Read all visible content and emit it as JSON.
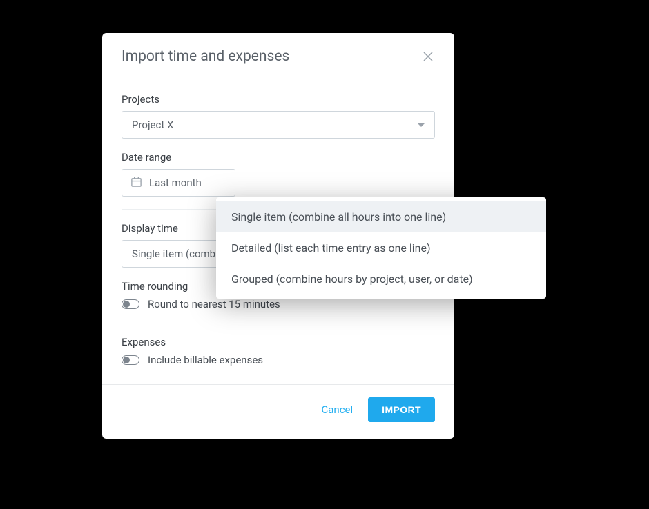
{
  "modal": {
    "title": "Import time and expenses",
    "projects": {
      "label": "Projects",
      "value": "Project X"
    },
    "date_range": {
      "label": "Date range",
      "value": "Last month"
    },
    "display_time": {
      "label": "Display time",
      "value": "Single item (combi",
      "options": [
        "Single item (combine all hours into one line)",
        "Detailed (list each time entry as one line)",
        "Grouped (combine hours by project, user, or date)"
      ]
    },
    "time_rounding": {
      "label": "Time rounding",
      "toggle_label": "Round to nearest 15 minutes"
    },
    "expenses": {
      "label": "Expenses",
      "toggle_label": "Include billable expenses"
    },
    "footer": {
      "cancel": "Cancel",
      "import": "IMPORT"
    }
  }
}
